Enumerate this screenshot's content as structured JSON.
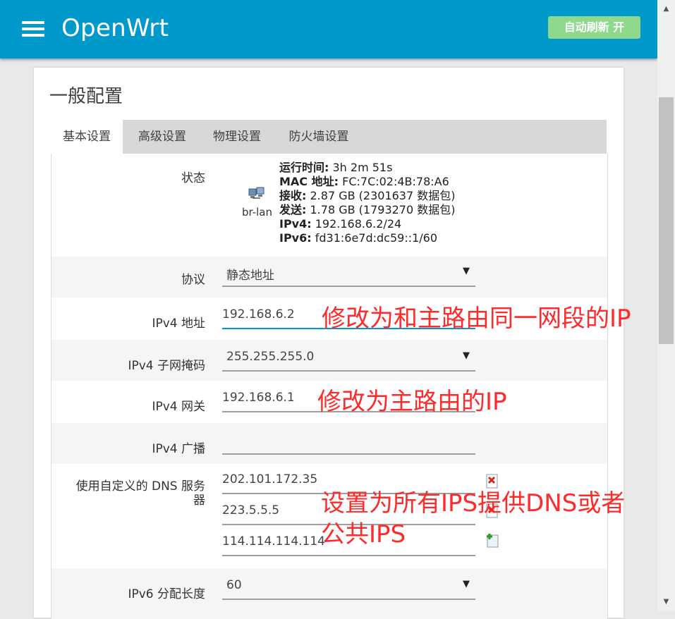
{
  "header": {
    "brand": "OpenWrt",
    "refresh_button": "自动刷新 开"
  },
  "page": {
    "section_title": "一般配置"
  },
  "tabs": [
    {
      "label": "基本设置",
      "active": true
    },
    {
      "label": "高级设置",
      "active": false
    },
    {
      "label": "物理设置",
      "active": false
    },
    {
      "label": "防火墙设置",
      "active": false
    }
  ],
  "status": {
    "label": "状态",
    "interface_name": "br-lan",
    "lines": [
      {
        "key": "运行时间:",
        "value": " 3h 2m 51s"
      },
      {
        "key": "MAC 地址:",
        "value": " FC:7C:02:4B:78:A6"
      },
      {
        "key": "接收:",
        "value": " 2.87 GB (2301637 数据包)"
      },
      {
        "key": "发送:",
        "value": " 1.78 GB (1793270 数据包)"
      },
      {
        "key": "IPv4:",
        "value": " 192.168.6.2/24"
      },
      {
        "key": "IPv6:",
        "value": " fd31:6e7d:dc59::1/60"
      }
    ]
  },
  "form": {
    "protocol": {
      "label": "协议",
      "value": "静态地址"
    },
    "ipv4_address": {
      "label": "IPv4 地址",
      "value": "192.168.6.2"
    },
    "ipv4_netmask": {
      "label": "IPv4 子网掩码",
      "value": "255.255.255.0"
    },
    "ipv4_gateway": {
      "label": "IPv4 网关",
      "value": "192.168.6.1"
    },
    "ipv4_broadcast": {
      "label": "IPv4 广播",
      "value": ""
    },
    "dns": {
      "label": "使用自定义的 DNS 服务器",
      "servers": [
        "202.101.172.35",
        "223.5.5.5",
        "114.114.114.114"
      ]
    },
    "ipv6_prefix_len": {
      "label": "IPv6 分配长度",
      "value": "60"
    }
  },
  "annotations": {
    "address_note": "修改为和主路由同一网段的IP",
    "gateway_note": "修改为主路由的IP",
    "dns_note_line1": "设置为所有IPS提供DNS或者",
    "dns_note_line2": "公共IPS"
  },
  "colors": {
    "header_bg": "#0099cc",
    "refresh_bg": "#8ed98e",
    "annotation": "#ff2a2a",
    "focus_underline": "#0099cc"
  }
}
